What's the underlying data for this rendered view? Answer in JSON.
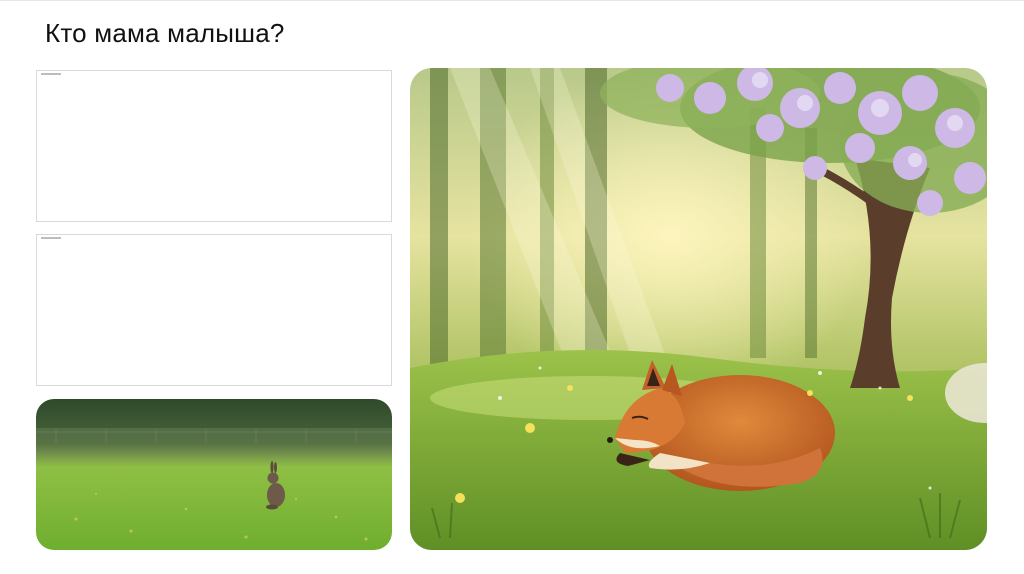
{
  "slide": {
    "title": "Кто мама малыша?"
  },
  "images": {
    "rabbit": "rabbit-in-field",
    "fox": "sleeping-fox-under-blossom-tree"
  },
  "colors": {
    "grass": "#7fb33a",
    "fox": "#c8672a",
    "blossom": "#c9b3e0"
  }
}
